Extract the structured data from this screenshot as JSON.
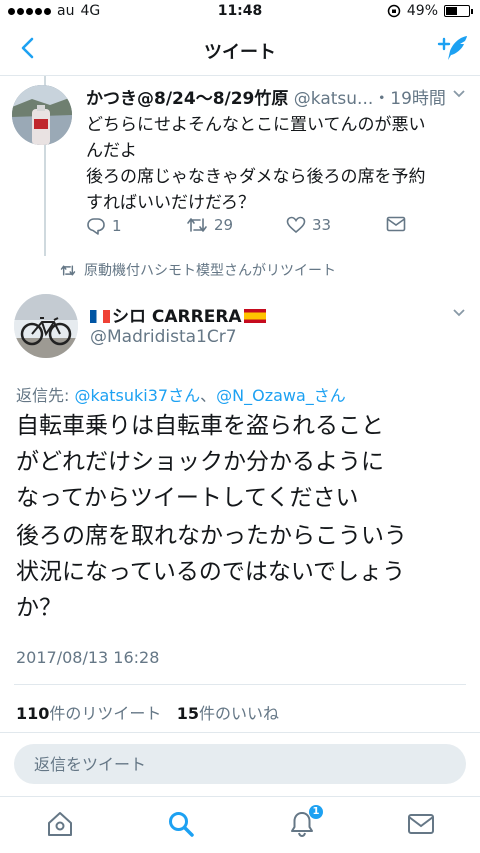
{
  "status_bar": {
    "carrier": "au",
    "network": "4G",
    "time": "11:48",
    "battery_percent": "49%",
    "battery_level": 0.49
  },
  "nav": {
    "title": "ツイート",
    "back_icon": "chevron-left-icon",
    "compose_icon": "compose-tweet-icon"
  },
  "parent_tweet": {
    "display_name": "かつき@8/24〜8/29竹原",
    "handle": "@katsu...",
    "time": "・19時間",
    "lines": [
      "どちらにせよそんなとこに置いてんのが悪い",
      "んだよ",
      "後ろの席じゃなきゃダメなら後ろの席を予約",
      "すればいいだけだろ？"
    ],
    "replies": "1",
    "retweets": "29",
    "likes": "33"
  },
  "retweet_note": "原動機付ハシモト模型さんがリツイート",
  "main_tweet": {
    "display_name": "シロ  CARRERA",
    "handle": "@Madridista1Cr7",
    "reply_prefix": "返信先: ",
    "reply_mention_1": "@katsuki37さん",
    "reply_separator": "、",
    "reply_mention_2": "@N_Ozawa_さん",
    "lines": [
      "自転車乗りは自転車を盗られること",
      "がどれだけショックか分かるように",
      "なってからツイートしてください",
      "後ろの席を取れなかったからこういう",
      "状況になっているのではないでしょう",
      "か？"
    ],
    "date": "2017/08/13 16:28",
    "retweet_count": "110",
    "retweet_label": "件のリツイート",
    "like_count": "15",
    "like_label": "件のいいね"
  },
  "reply_input": {
    "placeholder": "返信をツイート"
  },
  "tab_bar": {
    "notification_badge": "1",
    "items": [
      "home-icon",
      "search-icon",
      "notifications-icon",
      "messages-icon"
    ]
  },
  "colors": {
    "accent": "#1da1f2",
    "secondary_text": "#657786"
  }
}
